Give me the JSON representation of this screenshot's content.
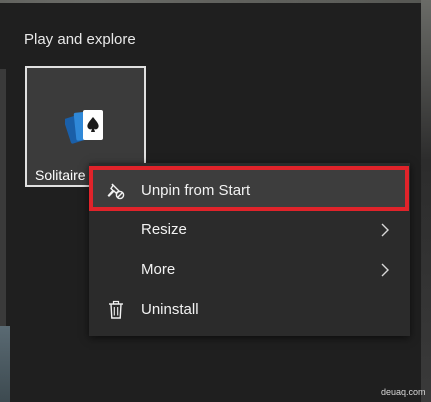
{
  "start": {
    "group_title": "Play and explore",
    "tile": {
      "label": "Solitaire",
      "icon": "solitaire-cards-icon"
    }
  },
  "context_menu": {
    "items": [
      {
        "label": "Unpin from Start",
        "icon": "unpin-icon",
        "highlighted": true
      },
      {
        "label": "Resize",
        "icon": "",
        "submenu": true
      },
      {
        "label": "More",
        "icon": "",
        "submenu": true
      },
      {
        "label": "Uninstall",
        "icon": "trash-icon"
      }
    ],
    "highlight_color": "#e0232a"
  },
  "watermark": "deuaq.com"
}
